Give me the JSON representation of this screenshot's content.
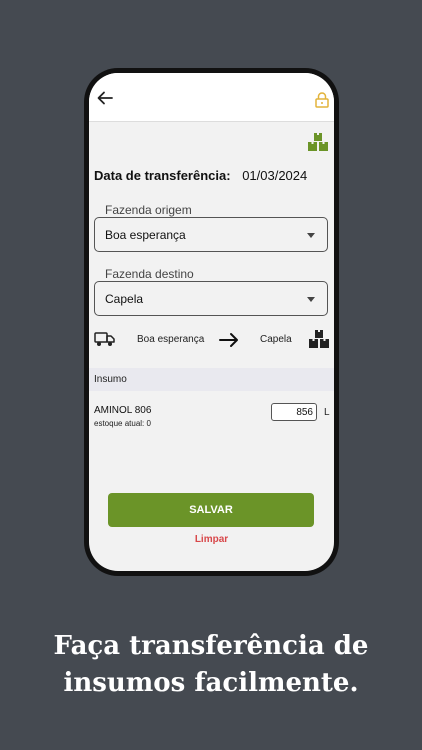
{
  "header": {
    "back_icon": "arrow-left-icon",
    "lock_icon": "lock-icon",
    "lock_color": "#e2b33a"
  },
  "form": {
    "date_label": "Data de transferência:",
    "date_value": "01/03/2024",
    "origin_label": "Fazenda origem",
    "origin_value": "Boa esperança",
    "destination_label": "Fazenda destino",
    "destination_value": "Capela"
  },
  "route": {
    "from": "Boa esperança",
    "to": "Capela",
    "truck_icon": "truck-icon",
    "arrow_icon": "arrow-right-icon",
    "boxes_icon": "boxes-icon"
  },
  "inputs_section": {
    "header": "Insumo",
    "items": [
      {
        "name": "AMINOL 806",
        "stock": "estoque atual: 0",
        "quantity": "856",
        "unit": "L"
      }
    ]
  },
  "actions": {
    "save_label": "SALVAR",
    "clear_label": "Limpar"
  },
  "caption": {
    "line1": "Faça transferência de",
    "line2": "insumos facilmente."
  },
  "colors": {
    "accent": "#6b9428",
    "danger": "#d8474a",
    "background": "#454a51"
  }
}
